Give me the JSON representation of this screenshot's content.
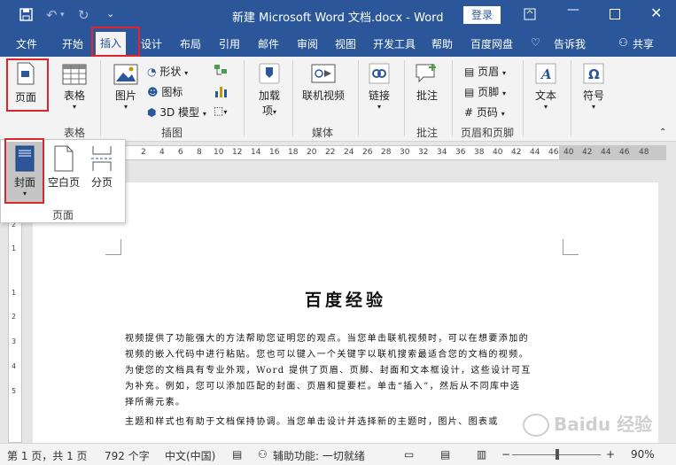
{
  "titlebar": {
    "title": "新建 Microsoft Word 文档.docx  -  Word",
    "login": "登录",
    "qa_more": "⌄"
  },
  "tabs": [
    "文件",
    "开始",
    "插入",
    "设计",
    "布局",
    "引用",
    "邮件",
    "审阅",
    "视图",
    "开发工具",
    "帮助",
    "百度网盘",
    "告诉我",
    "共享"
  ],
  "ribbon": {
    "pages_btn": "页面",
    "table_btn": "表格",
    "table_group": "表格",
    "picture_btn": "图片",
    "shapes": "形状",
    "icons": "图标",
    "model3d": "3D 模型",
    "illus_group": "插图",
    "addins_btn1": "加载",
    "addins_btn2": "项",
    "online_video": "联机视频",
    "media_group": "媒体",
    "links": "链接",
    "comment": "批注",
    "comment_group": "批注",
    "header": "页眉",
    "footer": "页脚",
    "page_number": "页码",
    "hf_group": "页眉和页脚",
    "text": "文本",
    "symbols": "符号"
  },
  "dropdown": {
    "cover": "封面",
    "blank": "空白页",
    "break": "分页",
    "group": "页面"
  },
  "ruler": {
    "h": [
      "2",
      "4",
      "6",
      "8",
      "10",
      "12",
      "14",
      "16",
      "18",
      "20",
      "22",
      "24",
      "26",
      "28",
      "30",
      "32",
      "34",
      "36",
      "38",
      "40",
      "42",
      "44",
      "46",
      "48"
    ],
    "v": [
      "2",
      "1",
      "1",
      "2",
      "3",
      "4",
      "5"
    ]
  },
  "document": {
    "title": "百度经验",
    "lines": [
      "视频提供了功能强大的方法帮助您证明您的观点。当您单击联机视频时，可以在想要添加的",
      "视频的嵌入代码中进行粘贴。您也可以键入一个关键字以联机搜索最适合您的文档的视频。",
      "为使您的文档具有专业外观，Word 提供了页眉、页脚、封面和文本框设计，这些设计可互",
      "为补充。例如，您可以添加匹配的封面、页眉和提要栏。单击“插入”，然后从不同库中选",
      "择所需元素。",
      "主题和样式也有助于文档保持协调。当您单击设计并选择新的主题时，图片、图表或"
    ]
  },
  "status": {
    "page": "第 1 页，共 1 页",
    "words": "792 个字",
    "lang": "中文(中国)",
    "accessibility": "辅助功能: 一切就绪",
    "zoom": "90%"
  },
  "colors": {
    "brand": "#2b579a",
    "highlight": "#e0242a"
  }
}
